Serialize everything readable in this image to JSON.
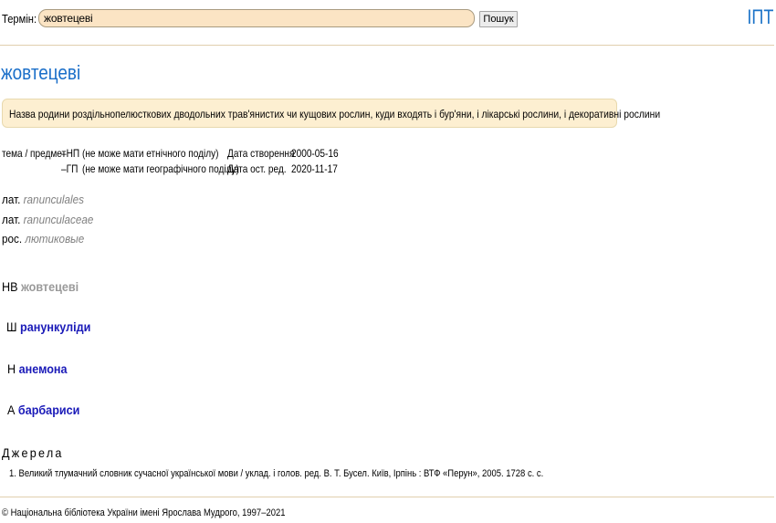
{
  "search": {
    "label": "Термін:",
    "value": "жовтецеві",
    "button_label": "Пошук"
  },
  "site_logo": "ІПТ",
  "term": {
    "title": "жовтецеві",
    "definition": "Назва родини роздільнопелюсткових дводольних трав'янистих чи кущових рослин, куди входять і бур'яни, і лікарські рослини, і декоративні рослини"
  },
  "meta": {
    "category_label": "тема / предмет",
    "np_code": "–НП",
    "np_desc": "(не може мати етнічного поділу)",
    "gp_code": "–ГП",
    "gp_desc": "(не може мати географічного поділу)",
    "created_label": "Дата створення",
    "created_value": "2000-05-16",
    "edited_label": "Дата ост. ред.",
    "edited_value": "2020-11-17"
  },
  "translations": [
    {
      "lang": "лат.",
      "term": "ranunculales"
    },
    {
      "lang": "лат.",
      "term": "ranunculaceae"
    },
    {
      "lang": "рос.",
      "term": "лютиковые"
    }
  ],
  "relations": [
    {
      "code": "НВ",
      "term": "жовтецеві"
    },
    {
      "code": "Ш",
      "term": "ранункуліди"
    },
    {
      "code": "Н",
      "term": "анемона"
    },
    {
      "code": "А",
      "term": "барбариси"
    }
  ],
  "sources": {
    "title": "Джерела",
    "items": [
      "1. Великий тлумачний словник сучасної української мови / уклад. і голов. ред. В. Т. Бусел. Київ, Ірпінь : ВТФ «Перун», 2005. 1728 с. с."
    ]
  },
  "footer": {
    "copyright": "© Національна бібліотека України імені Ярослава Мудрого, 1997–2021"
  }
}
